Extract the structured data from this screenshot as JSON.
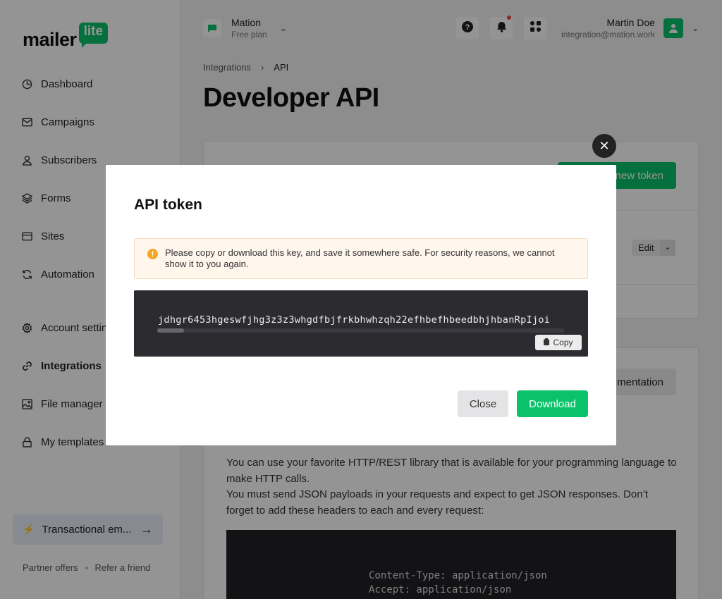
{
  "app": {
    "logo_text": "mailer",
    "logo_badge": "lite"
  },
  "sidebar": {
    "items": [
      {
        "label": "Dashboard",
        "icon": "dashboard-icon"
      },
      {
        "label": "Campaigns",
        "icon": "mail-icon"
      },
      {
        "label": "Subscribers",
        "icon": "user-icon"
      },
      {
        "label": "Forms",
        "icon": "layers-icon"
      },
      {
        "label": "Sites",
        "icon": "browser-icon"
      },
      {
        "label": "Automation",
        "icon": "refresh-icon"
      },
      {
        "label": "Account settings",
        "icon": "gear-icon"
      },
      {
        "label": "Integrations",
        "icon": "link-icon"
      },
      {
        "label": "File manager",
        "icon": "image-icon"
      },
      {
        "label": "My templates",
        "icon": "lock-icon"
      }
    ],
    "active": "Integrations",
    "promo_label": "Transactional em...",
    "partner_offers": "Partner offers",
    "refer_friend": "Refer a friend"
  },
  "topbar": {
    "workspace_name": "Mation",
    "workspace_plan": "Free plan",
    "user_name": "Martin Doe",
    "user_email": "integration@mation.work"
  },
  "breadcrumb": {
    "parent": "Integrations",
    "current": "API"
  },
  "page": {
    "title": "Developer API",
    "new_token_label": "new token",
    "edit_label": "Edit",
    "docs_label": "mentation",
    "body_line1": "You can use your favorite HTTP/REST library that is available for your programming language to make HTTP calls.",
    "body_line2": "You must send JSON payloads in your requests and expect to get JSON responses. Don’t forget to add these headers to each and every request:",
    "header1": "Content-Type: application/json",
    "header2": "Accept: application/json"
  },
  "modal": {
    "title": "API token",
    "warning": "Please copy or download this key, and save it somewhere safe. For security reasons, we cannot show it to you again.",
    "token": "jdhgr6453hgeswfjhg3z3z3whgdfbjfrkbhwhzqh22efhbefhbeedbhjhbanRpIjoi",
    "copy_label": "Copy",
    "close_label": "Close",
    "download_label": "Download"
  },
  "colors": {
    "accent": "#09c269",
    "warning": "#f5a623"
  }
}
